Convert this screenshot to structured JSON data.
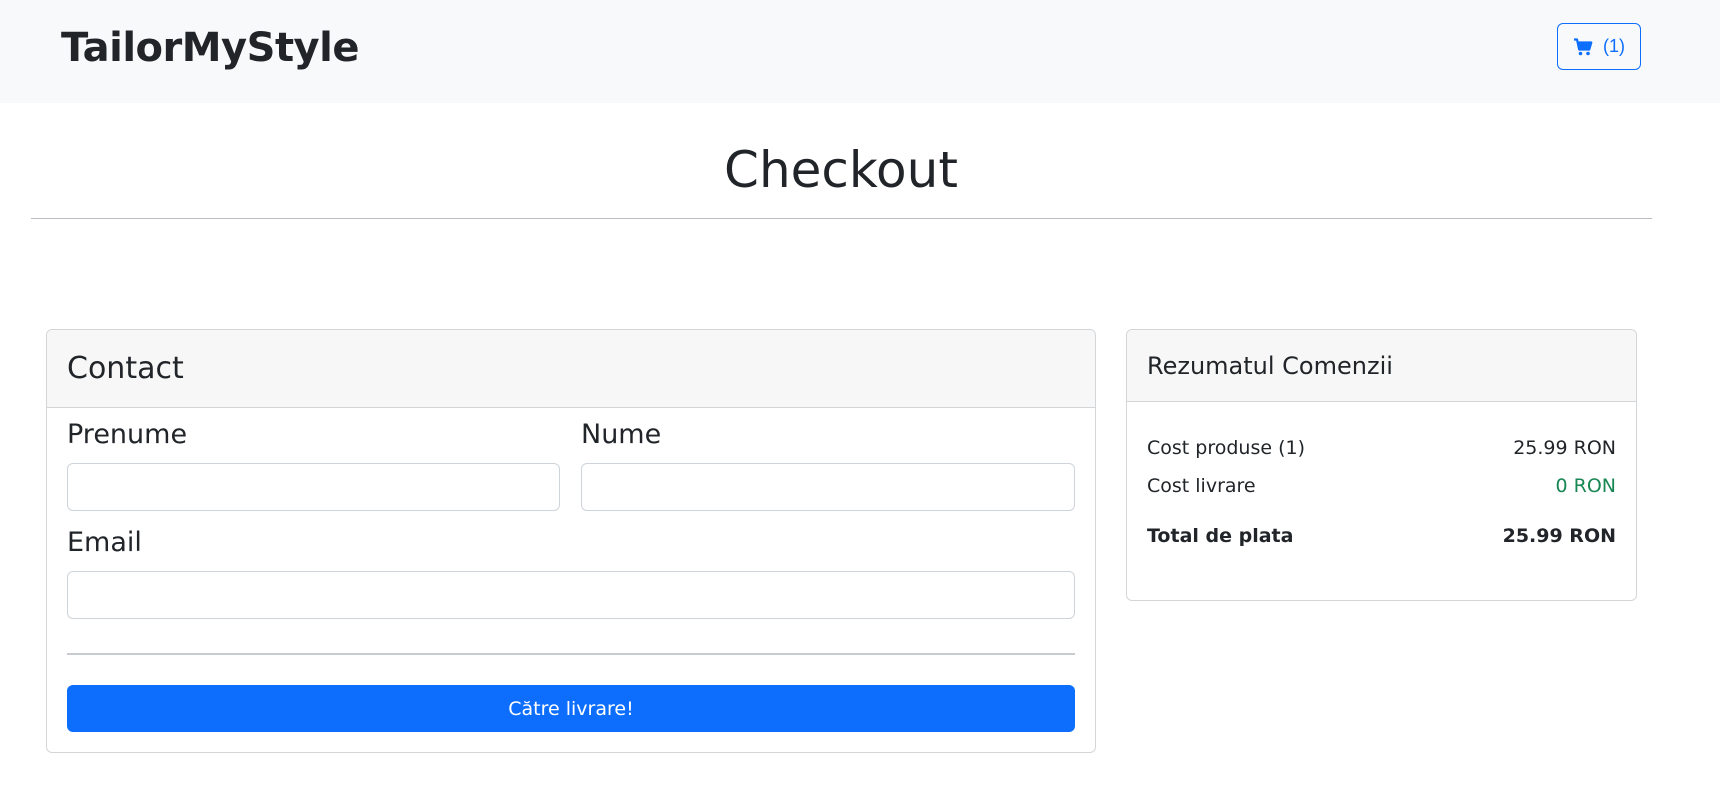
{
  "navbar": {
    "brand": "TailorMyStyle",
    "cart_count": "(1)",
    "cart_icon": "shopping-cart-icon"
  },
  "page": {
    "title": "Checkout"
  },
  "contact": {
    "title": "Contact",
    "first_name_label": "Prenume",
    "first_name_value": "",
    "last_name_label": "Nume",
    "last_name_value": "",
    "email_label": "Email",
    "email_value": "",
    "submit_label": "Către livrare!"
  },
  "summary": {
    "title": "Rezumatul Comenzii",
    "rows": [
      {
        "label": "Cost produse (1)",
        "value": "25.99 RON"
      },
      {
        "label": "Cost livrare",
        "value": "0 RON"
      }
    ],
    "total_label": "Total de plata",
    "total_value": "25.99 RON"
  },
  "colors": {
    "primary": "#0d6efd",
    "success": "#198754",
    "navbar_bg": "#f8f9fa"
  }
}
